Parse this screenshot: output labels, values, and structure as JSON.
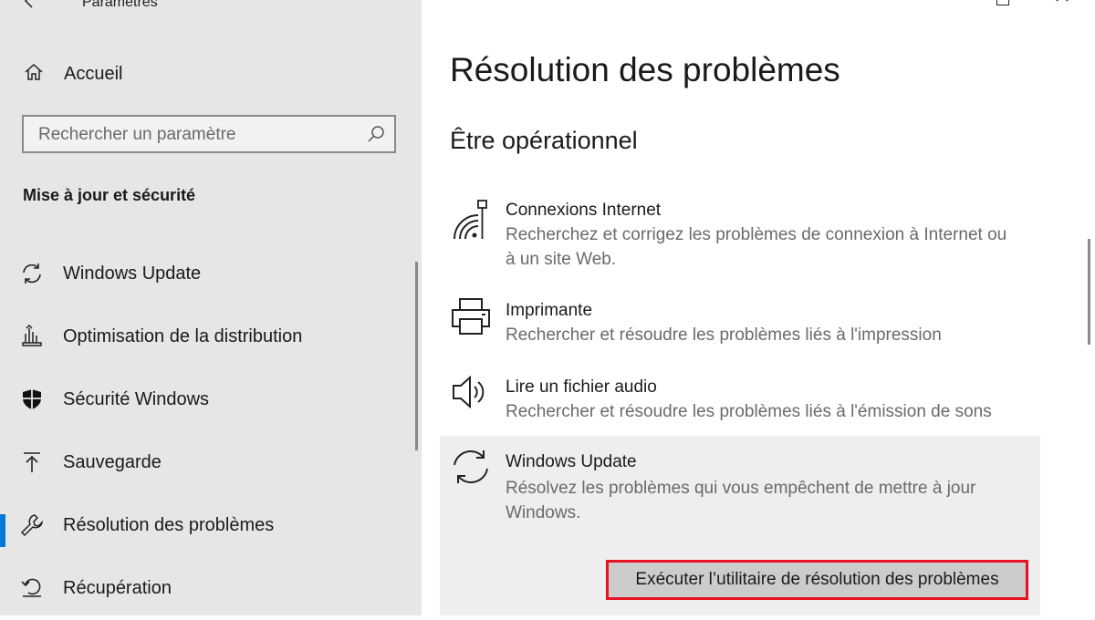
{
  "window": {
    "title": "Paramètres"
  },
  "sidebar": {
    "home_label": "Accueil",
    "search_placeholder": "Rechercher un paramètre",
    "section_title": "Mise à jour et sécurité",
    "items": [
      {
        "label": "Windows Update",
        "icon": "sync-icon"
      },
      {
        "label": "Optimisation de la distribution",
        "icon": "delivery-optimization-icon"
      },
      {
        "label": "Sécurité Windows",
        "icon": "shield-icon"
      },
      {
        "label": "Sauvegarde",
        "icon": "backup-arrow-icon"
      },
      {
        "label": "Résolution des problèmes",
        "icon": "wrench-icon",
        "selected": true
      },
      {
        "label": "Récupération",
        "icon": "recovery-icon"
      }
    ]
  },
  "main": {
    "title": "Résolution des problèmes",
    "subheading": "Être opérationnel",
    "troubleshooters": [
      {
        "name": "Connexions Internet",
        "description": "Recherchez et corrigez les problèmes de connexion à Internet ou à un site Web.",
        "icon": "wifi-ethernet-icon"
      },
      {
        "name": "Imprimante",
        "description": "Rechercher et résoudre les problèmes liés à l'impression",
        "icon": "printer-icon"
      },
      {
        "name": "Lire un fichier audio",
        "description": "Rechercher et résoudre les problèmes liés à l'émission de sons",
        "icon": "speaker-icon"
      },
      {
        "name": "Windows Update",
        "description": "Résolvez les problèmes qui vous empêchent de mettre à jour Windows.",
        "icon": "sync-icon",
        "expanded": true
      }
    ],
    "run_button_label": "Exécuter l’utilitaire de résolution des problèmes",
    "highlight_color": "#e81123",
    "accent_color": "#0078d7"
  }
}
